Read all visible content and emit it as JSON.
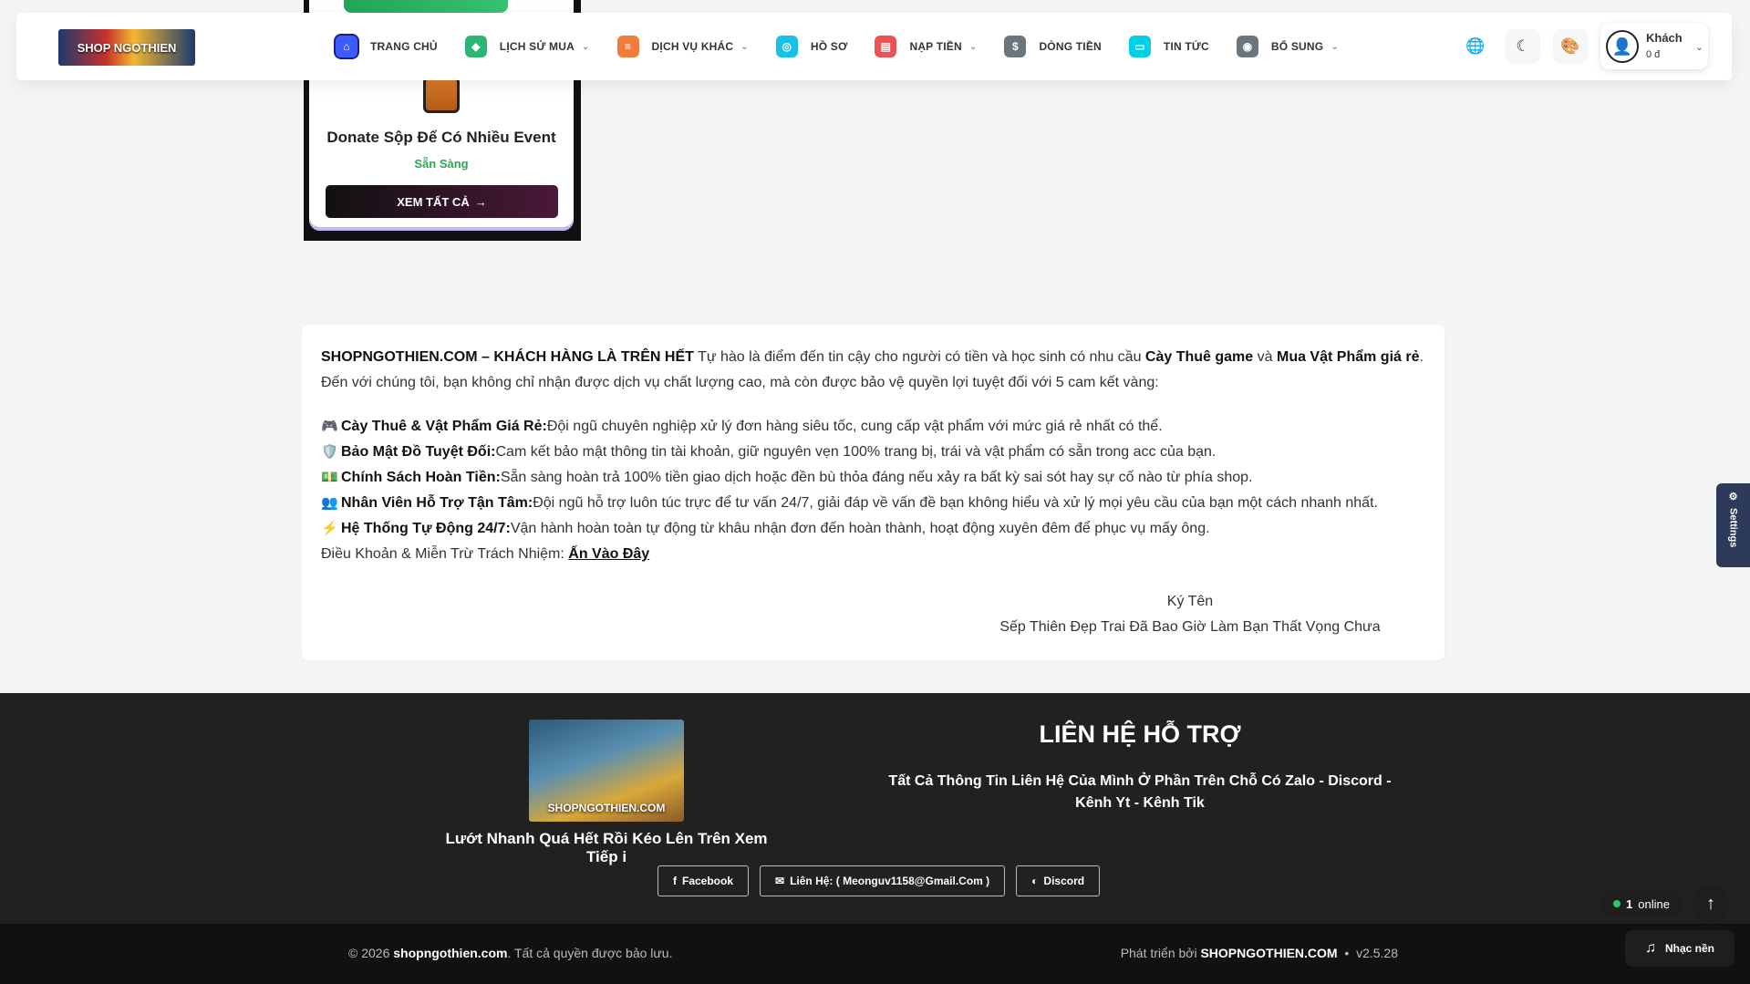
{
  "nav": {
    "logo_text": "SHOP NGOTHIEN",
    "items": [
      {
        "label": "TRANG CHỦ",
        "icon": "home-icon",
        "color": "#3d5afe",
        "dropdown": false
      },
      {
        "label": "LỊCH SỬ MUA",
        "icon": "gamepad-icon",
        "color": "#2bb673",
        "dropdown": true
      },
      {
        "label": "DỊCH VỤ KHÁC",
        "icon": "layers-icon",
        "color": "#f07c3c",
        "dropdown": true
      },
      {
        "label": "HỒ SƠ",
        "icon": "profile-icon",
        "color": "#17c1e8",
        "dropdown": false
      },
      {
        "label": "NẠP TIỀN",
        "icon": "wallet-icon",
        "color": "#ea5455",
        "dropdown": true
      },
      {
        "label": "DÒNG TIỀN",
        "icon": "dollar-icon",
        "color": "#6c757d",
        "dropdown": false
      },
      {
        "label": "TIN TỨC",
        "icon": "news-icon",
        "color": "#00cfe8",
        "dropdown": false
      },
      {
        "label": "BỔ SUNG",
        "icon": "info-icon",
        "color": "#6c757d",
        "dropdown": true
      }
    ],
    "user": {
      "name": "Khách",
      "balance": "0 đ"
    }
  },
  "card": {
    "title": "Donate Sộp Để Có Nhiều Event",
    "status": "Sẵn Sàng",
    "button": "XEM TẤT CẢ"
  },
  "about": {
    "brand": "SHOPNGOTHIEN.COM – KHÁCH HÀNG LÀ TRÊN HẾT",
    "intro_a": " Tự hào là điểm đến tin cậy cho người có tiền và học sinh có nhu cầu ",
    "intro_b": "Cày Thuê game",
    "intro_c": " và ",
    "intro_d": "Mua Vật Phẩm giá rẻ",
    "intro_e": ". Đến với chúng tôi, bạn không chỉ nhận được dịch vụ chất lượng cao, mà còn được bảo vệ quyền lợi tuyệt đối với 5 cam kết vàng:",
    "commitments": [
      {
        "emoji": "🎮",
        "title": "Cày Thuê & Vật Phẩm Giá Rẻ:",
        "text": " Đội ngũ chuyên nghiệp xử lý đơn hàng siêu tốc, cung cấp vật phẩm với mức giá rẻ nhất có thể."
      },
      {
        "emoji": "🛡️",
        "title": "Bảo Mật Đồ Tuyệt Đối:",
        "text": " Cam kết bảo mật thông tin tài khoản, giữ nguyên vẹn 100% trang bị, trái và vật phẩm có sẵn trong acc của bạn."
      },
      {
        "emoji": "💵",
        "title": "Chính Sách Hoàn Tiền:",
        "text": " Sẵn sàng hoàn trả 100% tiền giao dịch hoặc đền bù thỏa đáng nếu xảy ra bất kỳ sai sót hay sự cố nào từ phía shop."
      },
      {
        "emoji": "👥",
        "title": "Nhân Viên Hỗ Trợ Tận Tâm:",
        "text": " Đội ngũ hỗ trợ luôn túc trực để tư vấn 24/7, giải đáp về vấn đề bạn không hiểu và xử lý mọi yêu cầu của bạn một cách nhanh nhất."
      },
      {
        "emoji": "⚡",
        "title": "Hệ Thống Tự Động 24/7:",
        "text": " Vận hành hoàn toàn tự động từ khâu nhận đơn đến hoàn thành, hoạt động xuyên đêm để phục vụ mấy ông."
      }
    ],
    "terms_label": "Điều Khoản & Miễn Trừ Trách Nhiệm: ",
    "terms_link": "Ấn Vào Đây",
    "sig_1": "Ký Tên",
    "sig_2": "Sếp Thiên Đẹp Trai Đã Bao Giờ Làm Bạn Thất Vọng Chưa"
  },
  "footer": {
    "logo_text": "SHOPNGOTHIEN.COM",
    "tagline": "Lướt Nhanh Quá Hết Rồi Kéo Lên Trên Xem Tiếp i",
    "heading": "LIÊN HỆ HỖ TRỢ",
    "desc": "Tất Cả Thông Tin Liên Hệ Của Mình Ở Phần Trên Chỗ Có Zalo - Discord - Kênh Yt - Kênh Tik",
    "btn_facebook": "Facebook",
    "btn_contact": "Liên Hệ: ( Meonguv1158@Gmail.Com )",
    "btn_discord": "Discord"
  },
  "bottom": {
    "copy_a": "© 2026 ",
    "copy_site": "shopngothien.com",
    "copy_b": ". Tất cả quyền được bảo lưu.",
    "dev_label": "Phát triển bởi ",
    "dev_brand": "SHOPNGOTHIEN.COM",
    "version": "v2.5.28"
  },
  "widgets": {
    "online_count": "1",
    "online_label": "online",
    "music": "Nhạc nền",
    "settings": "Settings"
  }
}
